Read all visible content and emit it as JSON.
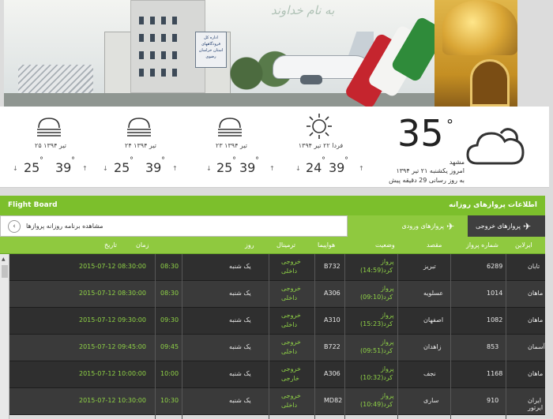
{
  "weather": {
    "now": {
      "temp": "35",
      "deg": "°",
      "city": "مشهد",
      "date": "امروز یکشنبه ۲۱ تیر ۱۳۹۴",
      "updated": "به روز رسانی 29 دقیقه پیش",
      "icon": "cloud-icon"
    },
    "days": [
      {
        "date": "فردا ۲۲ تیر ۱۳۹۴",
        "hi": "39",
        "lo": "24",
        "icon": "sun-icon"
      },
      {
        "date": "۲۳ تیر ۱۳۹۴",
        "hi": "39",
        "lo": "25",
        "icon": "fog-icon"
      },
      {
        "date": "۲۴ تیر ۱۳۹۴",
        "hi": "39",
        "lo": "25",
        "icon": "fog-icon"
      },
      {
        "date": "۲۵ تیر ۱۳۹۴",
        "hi": "39",
        "lo": "25",
        "icon": "fog-icon"
      }
    ],
    "deg": "°",
    "up": "↑",
    "down": "↓"
  },
  "board": {
    "title_en": "Flight Board",
    "title_fa": "اطلاعات پروازهای روزانه",
    "schedule_link": "مشاهده برنامه روزانه پروازها",
    "schedule_btn": "‹",
    "tab_arrivals": "پروازهای ورودی",
    "tab_departures": "پروازهای خروجی",
    "columns": {
      "airline": "ایرلاین",
      "flight": "شماره پرواز",
      "dest": "مقصد",
      "status": "وضعیت",
      "aircraft": "هواپیما",
      "terminal": "ترمینال",
      "day": "روز",
      "time": "زمان",
      "date": "تاریخ"
    },
    "rows": [
      {
        "airline": "تابان",
        "flight": "6289",
        "dest": "تبریز",
        "status1": "پرواز",
        "status2": "کرد(14:59)",
        "aircraft": "B732",
        "term1": "خروجی",
        "term2": "داخلی",
        "day": "یک شنبه",
        "time": "08:30",
        "date": "2015-07-12 08:30:00"
      },
      {
        "airline": "ماهان",
        "flight": "1014",
        "dest": "عسلویه",
        "status1": "پرواز",
        "status2": "کرد(09:10)",
        "aircraft": "A306",
        "term1": "خروجی",
        "term2": "داخلی",
        "day": "یک شنبه",
        "time": "08:30",
        "date": "2015-07-12 08:30:00"
      },
      {
        "airline": "ماهان",
        "flight": "1082",
        "dest": "اصفهان",
        "status1": "پرواز",
        "status2": "کرد(15:23)",
        "aircraft": "A310",
        "term1": "خروجی",
        "term2": "داخلی",
        "day": "یک شنبه",
        "time": "09:30",
        "date": "2015-07-12 09:30:00"
      },
      {
        "airline": "آسمان",
        "flight": "853",
        "dest": "زاهدان",
        "status1": "پرواز",
        "status2": "کرد(09:51)",
        "aircraft": "B722",
        "term1": "خروجی",
        "term2": "داخلی",
        "day": "یک شنبه",
        "time": "09:45",
        "date": "2015-07-12 09:45:00"
      },
      {
        "airline": "ماهان",
        "flight": "1168",
        "dest": "نجف",
        "status1": "پرواز",
        "status2": "کرد(10:32)",
        "aircraft": "A306",
        "term1": "خروجی",
        "term2": "خارجی",
        "day": "یک شنبه",
        "time": "10:00",
        "date": "2015-07-12 10:00:00"
      },
      {
        "airline": "ایران ایرتور",
        "flight": "910",
        "dest": "ساری",
        "status1": "پرواز",
        "status2": "کرد(10:49)",
        "aircraft": "MD82",
        "term1": "خروجی",
        "term2": "داخلی",
        "day": "یک شنبه",
        "time": "10:30",
        "date": "2015-07-12 10:30:00"
      }
    ]
  },
  "banner": {
    "sign_text": "اداره کل فرودگاههای استان خراسان رضوی",
    "script": "به نام خداوند"
  },
  "colors": {
    "green": "#7cbf2c",
    "row_dark": "#2f2f2f",
    "row_light": "#3a3a3a",
    "text_green": "#8fd246"
  }
}
